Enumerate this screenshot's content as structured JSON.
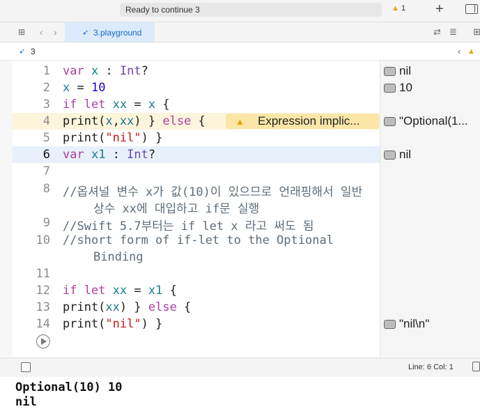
{
  "toolbar": {
    "status": "Ready to continue 3",
    "warning_count": "1",
    "add_symbol": "+"
  },
  "tab": {
    "label": "3.playground"
  },
  "breadcrumb": {
    "label": "3"
  },
  "warning": {
    "message": "Expression implic..."
  },
  "code_lines": [
    {
      "n": "1",
      "text": "var x : Int?"
    },
    {
      "n": "2",
      "text": "x = 10"
    },
    {
      "n": "3",
      "text": "if let xx = x {"
    },
    {
      "n": "4",
      "text": "print(x,xx) } else {"
    },
    {
      "n": "5",
      "text": "print(\"nil\") }"
    },
    {
      "n": "6",
      "text": "var x1 : Int?"
    },
    {
      "n": "7",
      "text": ""
    },
    {
      "n": "8",
      "text": "//옵셔널 변수 x가 값(10)이 있으므로 언래핑해서 일반 상수 xx에 대입하고 if문 실행"
    },
    {
      "n": "9",
      "text": "//Swift 5.7부터는 if let x 라고 써도 됨"
    },
    {
      "n": "10",
      "text": "//short form of if-let to the Optional Binding"
    },
    {
      "n": "11",
      "text": ""
    },
    {
      "n": "12",
      "text": "if let xx = x1 {"
    },
    {
      "n": "13",
      "text": "print(xx) } else {"
    },
    {
      "n": "14",
      "text": "print(\"nil\") }"
    }
  ],
  "comment_line8_a": "//옵셔널 변수 x가 값(10)이 있으므로 언래핑해서 일반",
  "comment_line8_b": "상수 xx에 대입하고 if문 실행",
  "comment_line9": "//Swift 5.7부터는 if let x 라고 써도 됨",
  "comment_line10_a": "//short form of if-let to the Optional",
  "comment_line10_b": "Binding",
  "results": {
    "r1": "nil",
    "r2": "10",
    "r4": "\"Optional(1...",
    "r6": "nil",
    "r14": "\"nil\\n\""
  },
  "debug": {
    "line_col": "Line: 6  Col: 1"
  },
  "console": {
    "line1": "Optional(10) 10",
    "line2": "nil"
  }
}
